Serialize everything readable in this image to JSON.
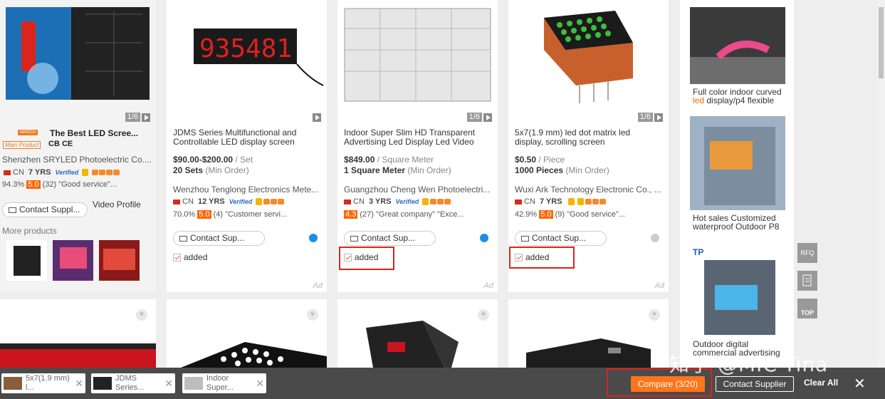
{
  "featured": {
    "img_count": "1/6",
    "march_badge": "MARCH",
    "main_product_badge": "Main Product",
    "cert": "CB CE",
    "title": "The Best LED Scree...",
    "supplier": "Shenzhen SRYLED Photoelectric Co....",
    "country": "CN",
    "years": "7 YRS",
    "verified": "Verified",
    "response": "94.3%",
    "score": "5.0",
    "reviews": "(32) \"Good service\"...",
    "contact": "Contact Suppl...",
    "video_profile": "Video Profile",
    "more_products": "More products"
  },
  "products": [
    {
      "img_count": "",
      "title": "JDMS Series Multifunctional and Controllable LED display screen",
      "price": "$90.00-$200.00",
      "unit": "/ Set",
      "moq": "20 Sets",
      "min_order": "(Min Order)",
      "supplier": "Wenzhou Tenglong Electronics Mete...",
      "country": "CN",
      "years": "12 YRS",
      "verified": "Verified",
      "response": "70.0%",
      "score": "5.0",
      "reviews": "(4) \"Customer servi...",
      "contact": "Contact Sup...",
      "added": "added",
      "ad": "Ad"
    },
    {
      "img_count": "1/6",
      "title": "Indoor Super Slim HD Transparent Advertising Led Display Led Video",
      "price": "$849.00",
      "unit": "/ Square Meter",
      "moq": "1 Square Meter",
      "min_order": "(Min Order)",
      "supplier": "Guangzhou Cheng Wen Photoelectri...",
      "country": "CN",
      "years": "3 YRS",
      "verified": "Verified",
      "response": "",
      "score": "4.3",
      "reviews": "(27) \"Great company\"  \"Exce...",
      "contact": "Contact Sup...",
      "added": "added",
      "ad": "Ad"
    },
    {
      "img_count": "1/6",
      "title": "5x7(1.9 mm) led dot matrix led display, scrolling screen",
      "price": "$0.50",
      "unit": "/ Piece",
      "moq": "1000 Pieces",
      "min_order": "(Min Order)",
      "supplier": "Wuxi Ark Technology Electronic Co., ...",
      "country": "CN",
      "years": "7 YRS",
      "verified": "",
      "response": "42.9%",
      "score": "5.0",
      "reviews": "(9) \"Good service\"...",
      "contact": "Contact Sup...",
      "added": "added",
      "ad": "Ad"
    }
  ],
  "right_column": [
    {
      "caption_pre": "Full color indoor curved ",
      "caption_hl": "led",
      "caption_post": " display/p4 flexible"
    },
    {
      "caption_pre": "Hot sales Customized waterproof Outdoor P8",
      "caption_hl": "",
      "caption_post": ""
    },
    {
      "caption_pre": "Outdoor digital commercial advertising",
      "caption_hl": "",
      "caption_post": ""
    }
  ],
  "side_buttons": {
    "rfq": "RFQ",
    "top": "TOP"
  },
  "compare_bar": {
    "items": [
      {
        "name": "5x7(1.9 mm) l..."
      },
      {
        "name": "JDMS Series..."
      },
      {
        "name": "Indoor Super..."
      }
    ],
    "compare_label": "Compare (3/20)",
    "contact_label": "Contact Supplier",
    "clear_label": "Clear All"
  },
  "watermark": "知乎 @MIC-Tina",
  "colors": {
    "accent": "#ff7519",
    "highlight_box": "#d9251b",
    "score_bg": "#ff6600"
  }
}
